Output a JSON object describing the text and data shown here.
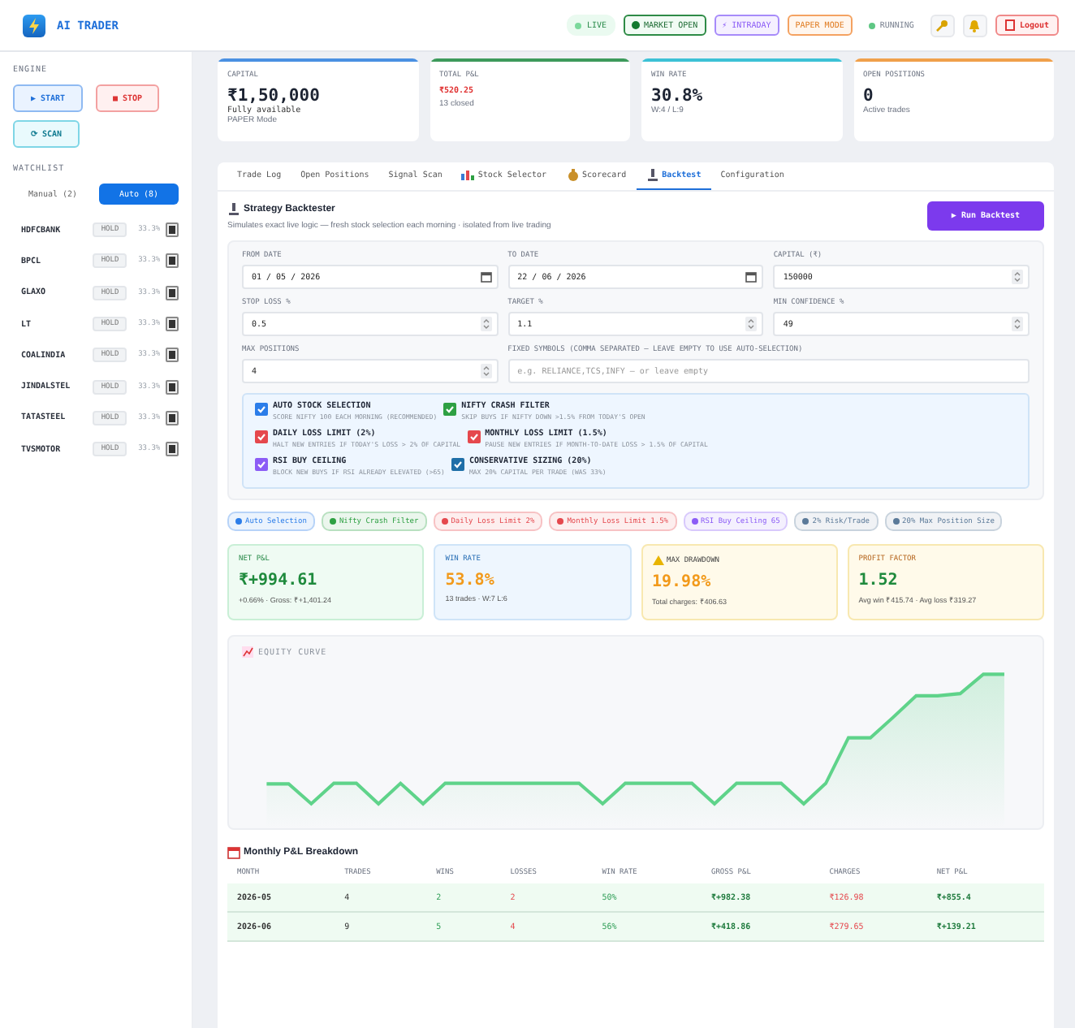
{
  "app": {
    "title": "AI TRADER"
  },
  "status_badges": [
    {
      "label": "LIVE",
      "kind": "dot-pill"
    },
    {
      "label": "MARKET OPEN",
      "kind": "market"
    },
    {
      "label": "⚡ INTRADAY",
      "kind": "intraday"
    },
    {
      "label": "PAPER MODE",
      "kind": "paper"
    },
    {
      "label": "RUNNING",
      "kind": "plain-dot"
    }
  ],
  "logout": {
    "label": "Logout"
  },
  "sidebar": {
    "engine_title": "ENGINE",
    "engine_buttons": [
      {
        "label": "▶ START",
        "kind": "start"
      },
      {
        "label": "■ STOP",
        "kind": "stop"
      },
      {
        "label": "⟳ SCAN",
        "kind": "scan"
      }
    ],
    "watchlist_title": "WATCHLIST",
    "modes": [
      {
        "label": "Manual (2)",
        "selected": false
      },
      {
        "label": "Auto (8)",
        "selected": true
      }
    ],
    "watchlist": [
      {
        "symbol": "HDFCBANK",
        "signal": "HOLD",
        "confidence": "33.3%"
      },
      {
        "symbol": "BPCL",
        "signal": "HOLD",
        "confidence": "33.3%"
      },
      {
        "symbol": "GLAXO",
        "signal": "HOLD",
        "confidence": "33.3%"
      },
      {
        "symbol": "LT",
        "signal": "HOLD",
        "confidence": "33.3%"
      },
      {
        "symbol": "COALINDIA",
        "signal": "HOLD",
        "confidence": "33.3%"
      },
      {
        "symbol": "JINDALSTEL",
        "signal": "HOLD",
        "confidence": "33.3%"
      },
      {
        "symbol": "TATASTEEL",
        "signal": "HOLD",
        "confidence": "33.3%"
      },
      {
        "symbol": "TVSMOTOR",
        "signal": "HOLD",
        "confidence": "33.3%"
      }
    ]
  },
  "stats": [
    {
      "label": "CAPITAL",
      "value": "₹1,50,000",
      "sub": [
        "Fully available",
        "PAPER Mode"
      ],
      "color": "#4a90e2",
      "kind": "plain"
    },
    {
      "label": "TOTAL P&L",
      "value": "₹520.25",
      "sub": [
        "13 closed"
      ],
      "color": "#3d9a5b",
      "kind": "negative"
    },
    {
      "label": "WIN RATE",
      "value": "30.8%",
      "sub": [
        "W:4 / L:9"
      ],
      "color": "#3cc1d6",
      "kind": "plain"
    },
    {
      "label": "OPEN POSITIONS",
      "value": "0",
      "sub": [
        "Active trades"
      ],
      "color": "#f0a04b",
      "kind": "plain"
    }
  ],
  "tabs": [
    {
      "label": "Trade Log",
      "selected": false,
      "has_icon": false
    },
    {
      "label": "Open Positions",
      "selected": false,
      "has_icon": false
    },
    {
      "label": "Signal Scan",
      "selected": false,
      "has_icon": false
    },
    {
      "label": "Stock Selector",
      "selected": false,
      "has_icon": true
    },
    {
      "label": "Scorecard",
      "selected": false,
      "has_icon": true
    },
    {
      "label": "Backtest",
      "selected": true,
      "has_icon": true
    },
    {
      "label": "Configuration",
      "selected": false,
      "has_icon": false
    }
  ],
  "backtest": {
    "title": "Strategy Backtester",
    "subtitle": "Simulates exact live logic — fresh stock selection each morning · isolated from live trading",
    "run_button": "▶ Run Backtest",
    "fields": [
      {
        "label": "FROM DATE",
        "value": "01 / 05 / 2026",
        "kind": "date"
      },
      {
        "label": "TO DATE",
        "value": "22 / 06 / 2026",
        "kind": "date"
      },
      {
        "label": "CAPITAL (₹)",
        "value": "150000",
        "kind": "number"
      },
      {
        "label": "STOP LOSS %",
        "value": "0.5",
        "kind": "number"
      },
      {
        "label": "TARGET %",
        "value": "1.1",
        "kind": "number"
      },
      {
        "label": "MIN CONFIDENCE %",
        "value": "49",
        "kind": "number"
      },
      {
        "label": "MAX POSITIONS",
        "value": "4",
        "kind": "number"
      },
      {
        "label": "FIXED SYMBOLS (COMMA SEPARATED — LEAVE EMPTY TO USE AUTO-SELECTION)",
        "placeholder": "e.g. RELIANCE,TCS,INFY — or leave empty",
        "kind": "text"
      }
    ],
    "options": [
      [
        {
          "title": "AUTO STOCK SELECTION",
          "desc": "SCORE NIFTY 100 EACH MORNING (RECOMMENDED)",
          "checked": true,
          "color": "#2b7de9"
        },
        {
          "title": "NIFTY CRASH FILTER",
          "desc": "SKIP BUYS IF NIFTY DOWN >1.5% FROM TODAY'S OPEN",
          "checked": true,
          "color": "#2ea043"
        }
      ],
      [
        {
          "title": "DAILY LOSS LIMIT (2%)",
          "desc": "HALT NEW ENTRIES IF TODAY'S LOSS > 2% OF CAPITAL",
          "checked": true,
          "color": "#e5484d"
        },
        {
          "title": "MONTHLY LOSS LIMIT (1.5%)",
          "desc": "PAUSE NEW ENTRIES IF MONTH-TO-DATE LOSS > 1.5% OF CAPITAL",
          "checked": true,
          "color": "#e5484d"
        }
      ],
      [
        {
          "title": "RSI BUY CEILING",
          "desc": "BLOCK NEW BUYS IF RSI ALREADY ELEVATED (>65)",
          "checked": true,
          "color": "#8b5cf6"
        },
        {
          "title": "CONSERVATIVE SIZING (20%)",
          "desc": "MAX 20% CAPITAL PER TRADE (WAS 33%)",
          "checked": true,
          "color": "#1f6fa8"
        }
      ]
    ],
    "chips": [
      {
        "label": "Auto Selection",
        "color": "#2b7de9"
      },
      {
        "label": "Nifty Crash Filter",
        "color": "#2ea043"
      },
      {
        "label": "Daily Loss Limit 2%",
        "color": "#e5484d"
      },
      {
        "label": "Monthly Loss Limit 1.5%",
        "color": "#e5484d"
      },
      {
        "label": "RSI Buy Ceiling 65",
        "color": "#8b5cf6"
      },
      {
        "label": "2% Risk/Trade",
        "color": "#5b7a99"
      },
      {
        "label": "20% Max Position Size",
        "color": "#5b7a99"
      }
    ],
    "metrics": [
      {
        "label": "NET P&L",
        "value": "₹+994.61",
        "sub": "+0.66% · Gross: ₹+1,401.24",
        "kind": "green",
        "has_icon": false
      },
      {
        "label": "WIN RATE",
        "value": "53.8%",
        "sub": "13 trades · W:7 L:6",
        "kind": "blue",
        "has_icon": false
      },
      {
        "label": "MAX DRAWDOWN",
        "value": "19.98%",
        "sub": "Total charges: ₹406.63",
        "kind": "amber",
        "has_icon": true
      },
      {
        "label": "PROFIT FACTOR",
        "value": "1.52",
        "sub": "Avg win ₹415.74 · Avg loss ₹319.27",
        "kind": "mixed",
        "has_icon": false
      }
    ],
    "equity_title": "EQUITY CURVE",
    "monthly_title": "Monthly P&L Breakdown",
    "table": {
      "columns": [
        {
          "label": "MONTH",
          "kind": "strong"
        },
        {
          "label": "TRADES",
          "kind": "plain"
        },
        {
          "label": "WINS",
          "kind": "positive"
        },
        {
          "label": "LOSSES",
          "kind": "negative"
        },
        {
          "label": "WIN RATE",
          "kind": "positive"
        },
        {
          "label": "GROSS P&L",
          "kind": "total"
        },
        {
          "label": "CHARGES",
          "kind": "negative"
        },
        {
          "label": "NET P&L",
          "kind": "total"
        }
      ],
      "rows": [
        [
          "2026-05",
          "4",
          "2",
          "2",
          "50%",
          "₹+982.38",
          "₹126.98",
          "₹+855.4"
        ],
        [
          "2026-06",
          "9",
          "5",
          "4",
          "56%",
          "₹+418.86",
          "₹279.65",
          "₹+139.21"
        ]
      ]
    }
  }
}
